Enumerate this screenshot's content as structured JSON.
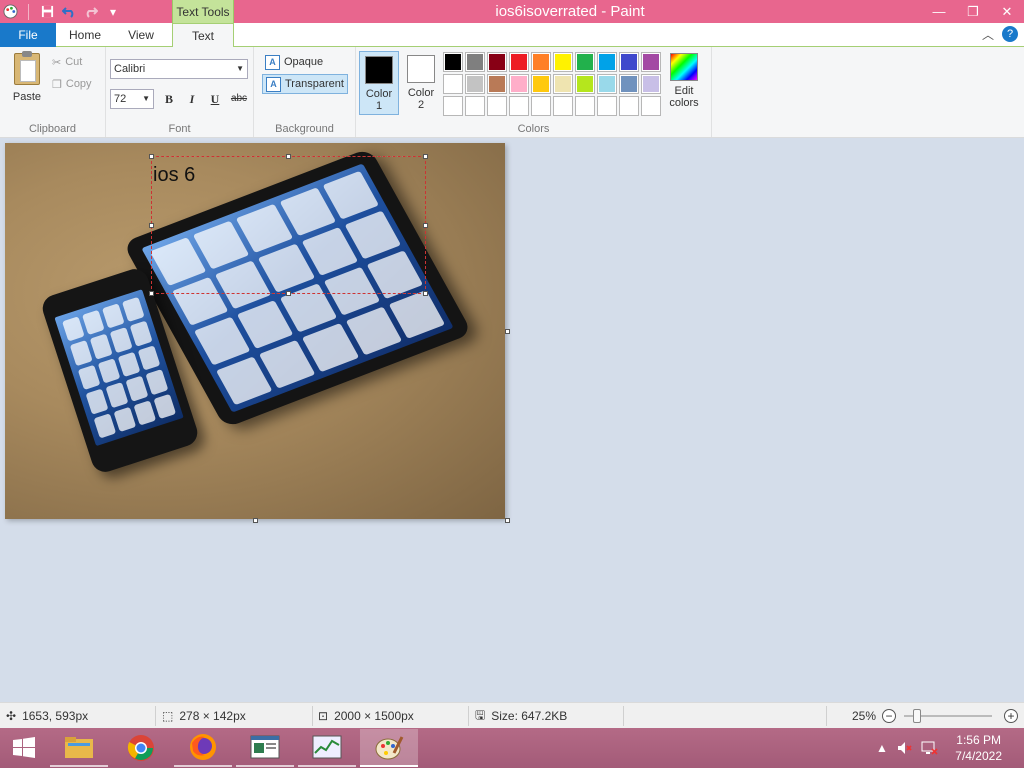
{
  "window": {
    "title": "ios6isoverrated - Paint",
    "context_tab": "Text Tools"
  },
  "tabs": {
    "file": "File",
    "home": "Home",
    "view": "View",
    "text": "Text"
  },
  "clipboard": {
    "paste": "Paste",
    "cut": "Cut",
    "copy": "Copy",
    "group_label": "Clipboard"
  },
  "font": {
    "family": "Calibri",
    "size": "72",
    "bold": "B",
    "italic": "I",
    "underline": "U",
    "strike": "abc",
    "group_label": "Font"
  },
  "background": {
    "opaque": "Opaque",
    "transparent": "Transparent",
    "selected": "transparent",
    "group_label": "Background"
  },
  "colors": {
    "color1_label": "Color\n1",
    "color1_l1": "Color",
    "color1_l2": "1",
    "color2_l1": "Color",
    "color2_l2": "2",
    "color1_value": "#000000",
    "color2_value": "#ffffff",
    "edit_l1": "Edit",
    "edit_l2": "colors",
    "group_label": "Colors",
    "palette_row1": [
      "#000000",
      "#7f7f7f",
      "#880015",
      "#ed1c24",
      "#ff7f27",
      "#fff200",
      "#22b14c",
      "#00a2e8",
      "#3f48cc",
      "#a349a4"
    ],
    "palette_row2": [
      "#ffffff",
      "#c3c3c3",
      "#b97a57",
      "#ffaec9",
      "#ffc90e",
      "#efe4b0",
      "#b5e61d",
      "#99d9ea",
      "#7092be",
      "#c8bfe7"
    ]
  },
  "canvas": {
    "inserted_text": "ios 6"
  },
  "status": {
    "cursor_pos": "1653, 593px",
    "selection_size": "278 × 142px",
    "image_size": "2000 × 1500px",
    "file_size": "Size: 647.2KB",
    "zoom": "25%"
  },
  "taskbar": {
    "time": "1:56 PM",
    "date": "7/4/2022"
  }
}
